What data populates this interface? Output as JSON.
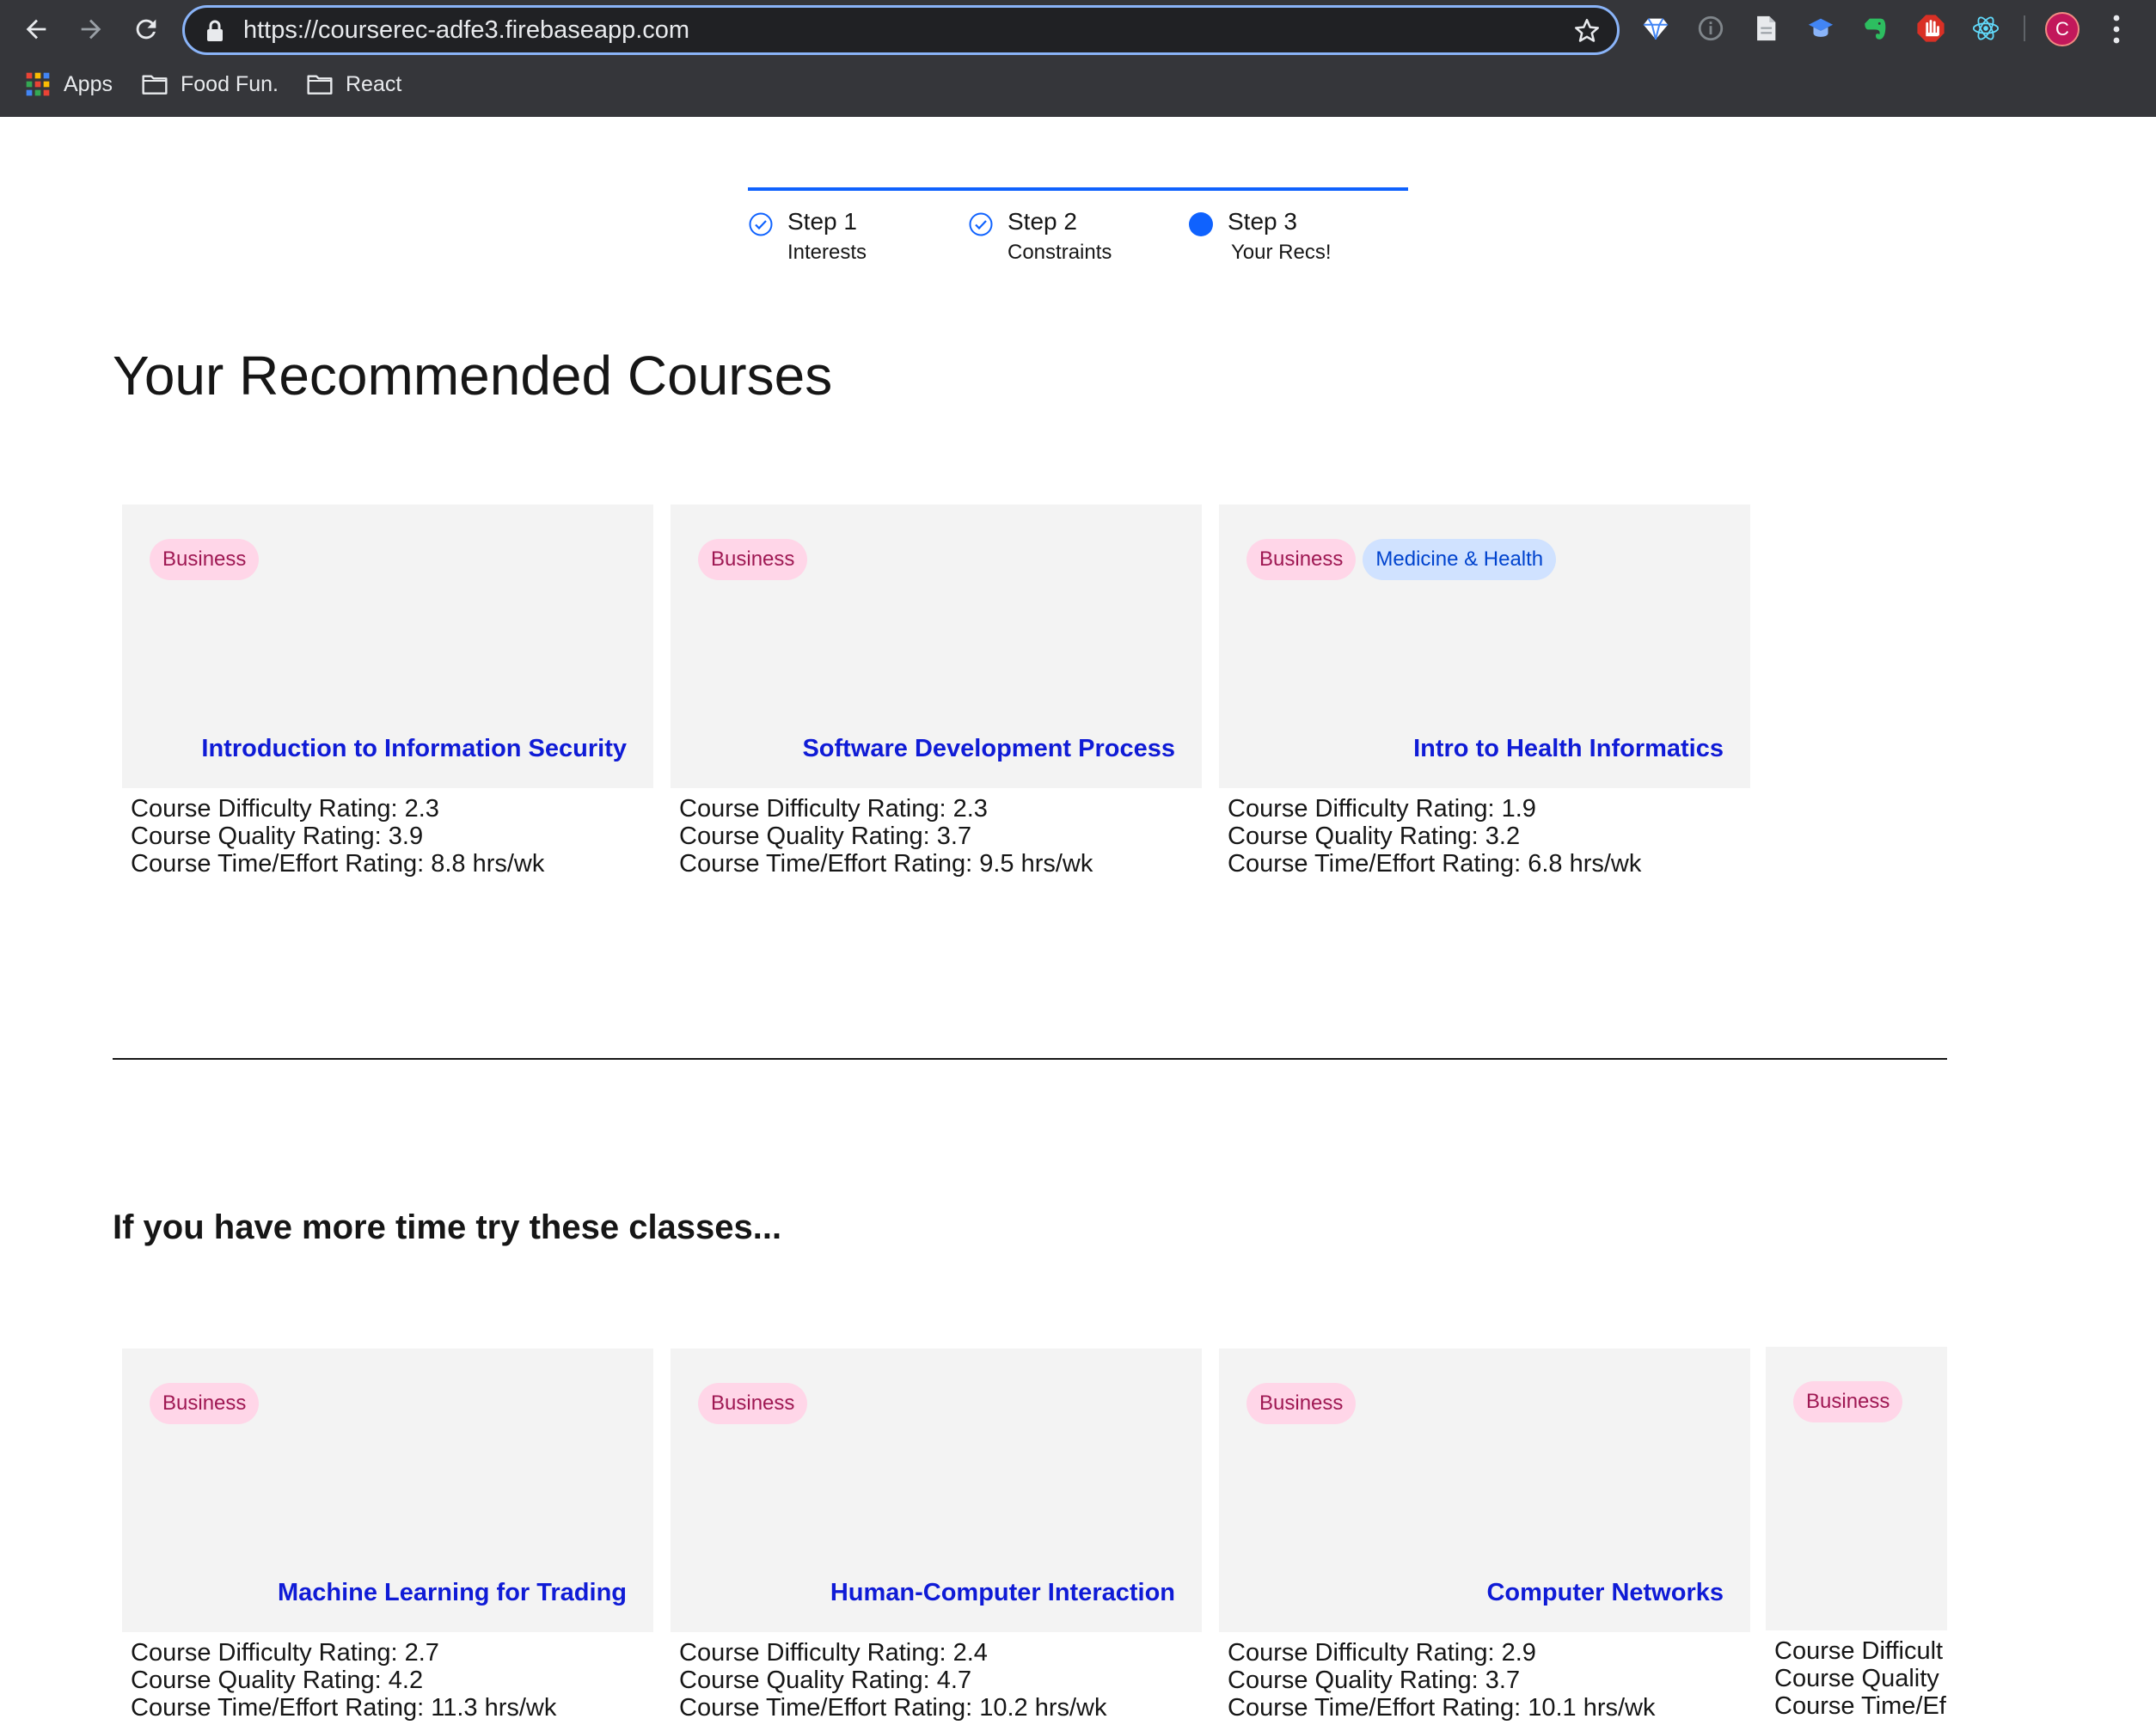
{
  "browser": {
    "url": "https://courserec-adfe3.firebaseapp.com",
    "profile_initial": "C",
    "bookmarks": [
      {
        "label": "Apps",
        "icon": "apps-grid-icon"
      },
      {
        "label": "Food Fun.",
        "icon": "folder-icon"
      },
      {
        "label": "React",
        "icon": "folder-icon"
      }
    ]
  },
  "stepper": {
    "steps": [
      {
        "title": "Step 1",
        "subtitle": "Interests",
        "state": "complete"
      },
      {
        "title": "Step 2",
        "subtitle": "Constraints",
        "state": "complete"
      },
      {
        "title": "Step 3",
        "subtitle": "Your Recs!",
        "state": "current"
      }
    ]
  },
  "page_title": "Your Recommended Courses",
  "recommended": [
    {
      "tags": [
        "Business"
      ],
      "title": "Introduction to Information Security",
      "difficulty": "Course Difficulty Rating: 2.3",
      "quality": "Course Quality Rating: 3.9",
      "effort": "Course Time/Effort Rating: 8.8 hrs/wk"
    },
    {
      "tags": [
        "Business"
      ],
      "title": "Software Development Process",
      "difficulty": "Course Difficulty Rating: 2.3",
      "quality": "Course Quality Rating: 3.7",
      "effort": "Course Time/Effort Rating: 9.5 hrs/wk"
    },
    {
      "tags": [
        "Business",
        "Medicine & Health"
      ],
      "title": "Intro to Health Informatics",
      "difficulty": "Course Difficulty Rating: 1.9",
      "quality": "Course Quality Rating: 3.2",
      "effort": "Course Time/Effort Rating: 6.8 hrs/wk"
    }
  ],
  "more_title": "If you have more time try these classes...",
  "more": [
    {
      "tags": [
        "Business"
      ],
      "title": "Machine Learning for Trading",
      "difficulty": "Course Difficulty Rating: 2.7",
      "quality": "Course Quality Rating: 4.2",
      "effort": "Course Time/Effort Rating: 11.3 hrs/wk"
    },
    {
      "tags": [
        "Business"
      ],
      "title": "Human-Computer Interaction",
      "difficulty": "Course Difficulty Rating: 2.4",
      "quality": "Course Quality Rating: 4.7",
      "effort": "Course Time/Effort Rating: 10.2 hrs/wk"
    },
    {
      "tags": [
        "Business"
      ],
      "title": "Computer Networks",
      "difficulty": "Course Difficulty Rating: 2.9",
      "quality": "Course Quality Rating: 3.7",
      "effort": "Course Time/Effort Rating: 10.1 hrs/wk"
    },
    {
      "tags": [
        "Business"
      ],
      "title": "",
      "difficulty": "Course Difficult",
      "quality": "Course Quality",
      "effort": "Course Time/Ef"
    }
  ],
  "colors": {
    "chrome_bg": "#35363a",
    "accent_blue": "#0f62fe",
    "course_title": "#0f1bd6",
    "tag_business_bg": "#ffd6e8",
    "tag_business_text": "#9f1853",
    "tag_health_bg": "#d0e2ff",
    "tag_health_text": "#0043ce",
    "tile_bg": "#f3f3f3"
  }
}
